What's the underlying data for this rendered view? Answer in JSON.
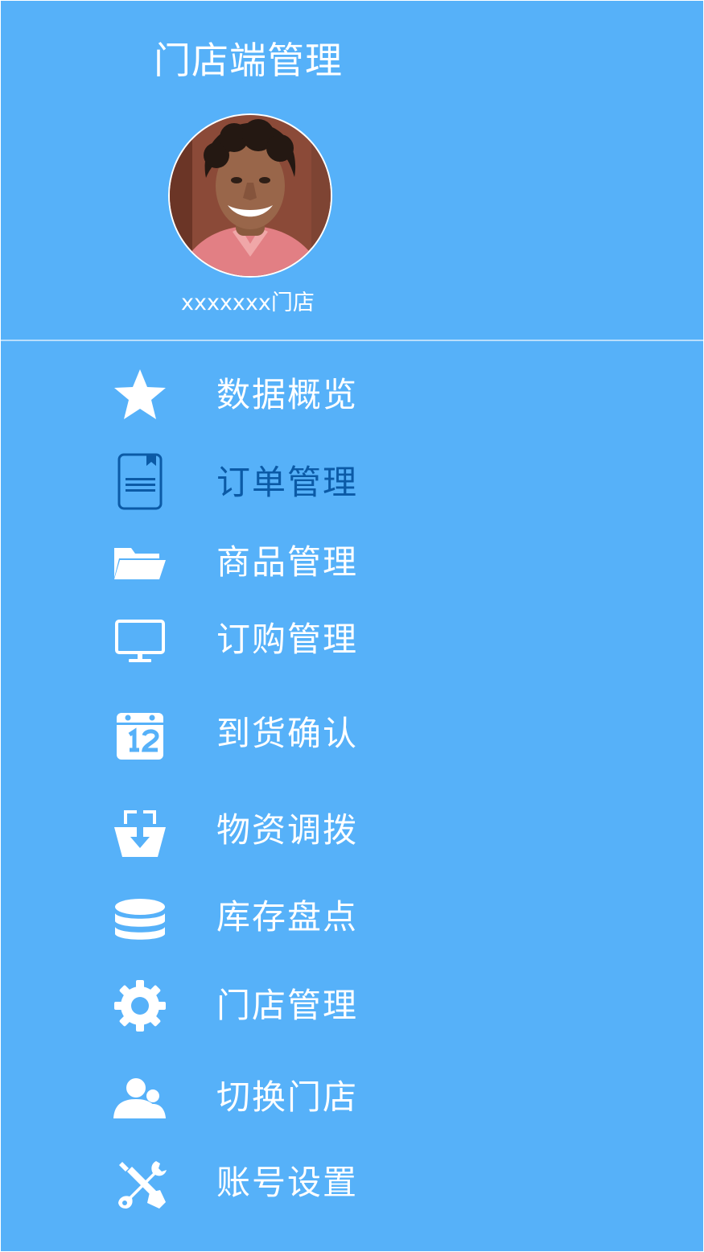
{
  "header": {
    "title": "门店端管理",
    "store_name": "xxxxxxx门店"
  },
  "colors": {
    "background": "#56b1f9",
    "text": "#ffffff",
    "active": "#0b5aa6",
    "divider": "#b9defc"
  },
  "menu": {
    "items": [
      {
        "label": "数据概览",
        "icon": "star-icon",
        "active": false
      },
      {
        "label": "订单管理",
        "icon": "document-icon",
        "active": true
      },
      {
        "label": "商品管理",
        "icon": "folder-icon",
        "active": false
      },
      {
        "label": "订购管理",
        "icon": "monitor-icon",
        "active": false
      },
      {
        "label": "到货确认",
        "icon": "calendar-icon",
        "active": false
      },
      {
        "label": "物资调拨",
        "icon": "transfer-basket-icon",
        "active": false
      },
      {
        "label": "库存盘点",
        "icon": "stack-icon",
        "active": false
      },
      {
        "label": "门店管理",
        "icon": "gear-icon",
        "active": false
      },
      {
        "label": "切换门店",
        "icon": "users-icon",
        "active": false
      },
      {
        "label": "账号设置",
        "icon": "tools-icon",
        "active": false
      }
    ]
  }
}
